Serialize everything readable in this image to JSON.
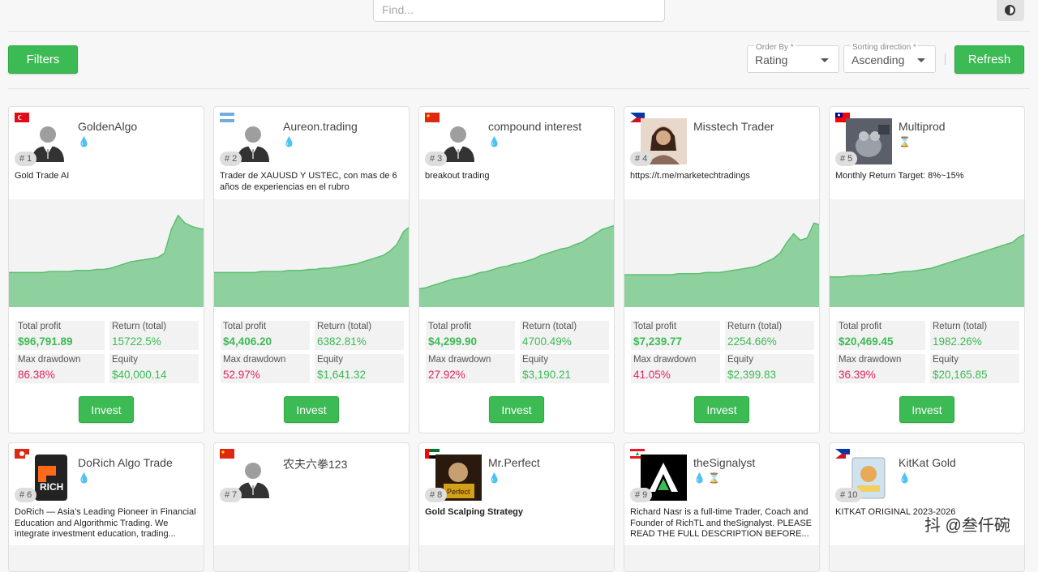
{
  "search": {
    "placeholder": "Find..."
  },
  "toolbar": {
    "filters_label": "Filters",
    "refresh_label": "Refresh",
    "order_by": {
      "label": "Order By *",
      "value": "Rating"
    },
    "sort_direction": {
      "label": "Sorting direction *",
      "value": "Ascending"
    }
  },
  "colors": {
    "accent": "#3cba54",
    "chart_fill": "#8fd19e",
    "chart_line": "#5bbf70",
    "negative": "#e0245e"
  },
  "stat_labels": {
    "profit": "Total profit",
    "ret": "Return (total)",
    "dd": "Max drawdown",
    "eq": "Equity"
  },
  "invest_label": "Invest",
  "cards": [
    {
      "rank": "# 1",
      "name": "GoldenAlgo",
      "flag": "turkey",
      "badge": "flame-icon",
      "desc": "Gold Trade AI",
      "profit": "$96,791.89",
      "ret": "15722.5%",
      "dd": "86.38%",
      "eq": "$40,000.14",
      "chart": [
        0.32,
        0.32,
        0.32,
        0.32,
        0.32,
        0.32,
        0.33,
        0.33,
        0.33,
        0.33,
        0.34,
        0.34,
        0.34,
        0.35,
        0.35,
        0.36,
        0.38,
        0.4,
        0.42,
        0.43,
        0.44,
        0.45,
        0.46,
        0.5,
        0.72,
        0.85,
        0.78,
        0.75,
        0.73,
        0.72
      ]
    },
    {
      "rank": "# 2",
      "name": "Aureon.trading",
      "flag": "argentina",
      "badge": "flame-icon",
      "desc": "Trader de XAUUSD Y USTEC, con mas de 6 años de experiencias en el rubro",
      "profit": "$4,406.20",
      "ret": "6382.81%",
      "dd": "52.97%",
      "eq": "$1,641.32",
      "chart": [
        0.32,
        0.32,
        0.32,
        0.32,
        0.32,
        0.32,
        0.32,
        0.33,
        0.33,
        0.33,
        0.33,
        0.34,
        0.34,
        0.34,
        0.35,
        0.35,
        0.36,
        0.36,
        0.37,
        0.38,
        0.39,
        0.4,
        0.42,
        0.44,
        0.46,
        0.48,
        0.52,
        0.58,
        0.7,
        0.75
      ]
    },
    {
      "rank": "# 3",
      "name": "compound interest",
      "flag": "china",
      "badge": "flame-icon",
      "desc": "breakout trading",
      "profit": "$4,299.90",
      "ret": "4700.49%",
      "dd": "27.92%",
      "eq": "$3,190.21",
      "chart": [
        0.17,
        0.18,
        0.2,
        0.22,
        0.24,
        0.26,
        0.27,
        0.28,
        0.3,
        0.32,
        0.33,
        0.35,
        0.37,
        0.38,
        0.4,
        0.41,
        0.43,
        0.45,
        0.48,
        0.5,
        0.52,
        0.54,
        0.55,
        0.58,
        0.6,
        0.64,
        0.68,
        0.72,
        0.74,
        0.76
      ]
    },
    {
      "rank": "# 4",
      "name": "Misstech Trader",
      "flag": "philippines",
      "badge": "",
      "desc": "https://t.me/marketechtradings",
      "profit": "$7,239.77",
      "ret": "2254.66%",
      "dd": "41.05%",
      "eq": "$2,399.83",
      "chart": [
        0.3,
        0.3,
        0.3,
        0.3,
        0.3,
        0.3,
        0.3,
        0.3,
        0.31,
        0.31,
        0.31,
        0.31,
        0.32,
        0.32,
        0.32,
        0.33,
        0.34,
        0.35,
        0.36,
        0.37,
        0.39,
        0.42,
        0.45,
        0.5,
        0.6,
        0.68,
        0.62,
        0.64,
        0.78,
        0.76
      ]
    },
    {
      "rank": "# 5",
      "name": "Multiprod",
      "flag": "taiwan",
      "badge": "hourglass-icon",
      "desc": "Monthly Return Target: 8%~15%",
      "profit": "$20,469.45",
      "ret": "1982.26%",
      "dd": "36.39%",
      "eq": "$20,165.85",
      "chart": [
        0.28,
        0.28,
        0.28,
        0.29,
        0.29,
        0.29,
        0.3,
        0.3,
        0.31,
        0.31,
        0.32,
        0.33,
        0.33,
        0.34,
        0.35,
        0.36,
        0.38,
        0.4,
        0.42,
        0.44,
        0.46,
        0.48,
        0.5,
        0.52,
        0.54,
        0.56,
        0.58,
        0.6,
        0.65,
        0.68
      ]
    },
    {
      "rank": "# 6",
      "name": "DoRich Algo Trade",
      "flag": "hongkong",
      "badge": "flame-icon",
      "desc": "DoRich — Asia’s Leading Pioneer in Financial Education and Algorithmic Trading. We integrate investment education, trading..."
    },
    {
      "rank": "# 7",
      "name": "农夫六拳123",
      "flag": "china",
      "badge": "",
      "desc": ""
    },
    {
      "rank": "# 8",
      "name": "Mr.Perfect",
      "flag": "uae",
      "badge": "flame-icon",
      "desc": "Gold Scalping Strategy"
    },
    {
      "rank": "# 9",
      "name": "theSignalyst",
      "flag": "lebanon",
      "badge": "flame-hourglass-icon",
      "desc": "Richard Nasr is a full-time Trader, Coach and Founder of RichTL and theSignalyst. PLEASE READ THE FULL DESCRIPTION BEFORE..."
    },
    {
      "rank": "# 10",
      "name": "KitKat Gold",
      "flag": "philippines",
      "badge": "flame-icon",
      "desc": "KITKAT ORIGINAL 2023-2026"
    }
  ],
  "watermark": "抖 @叁仟碗"
}
